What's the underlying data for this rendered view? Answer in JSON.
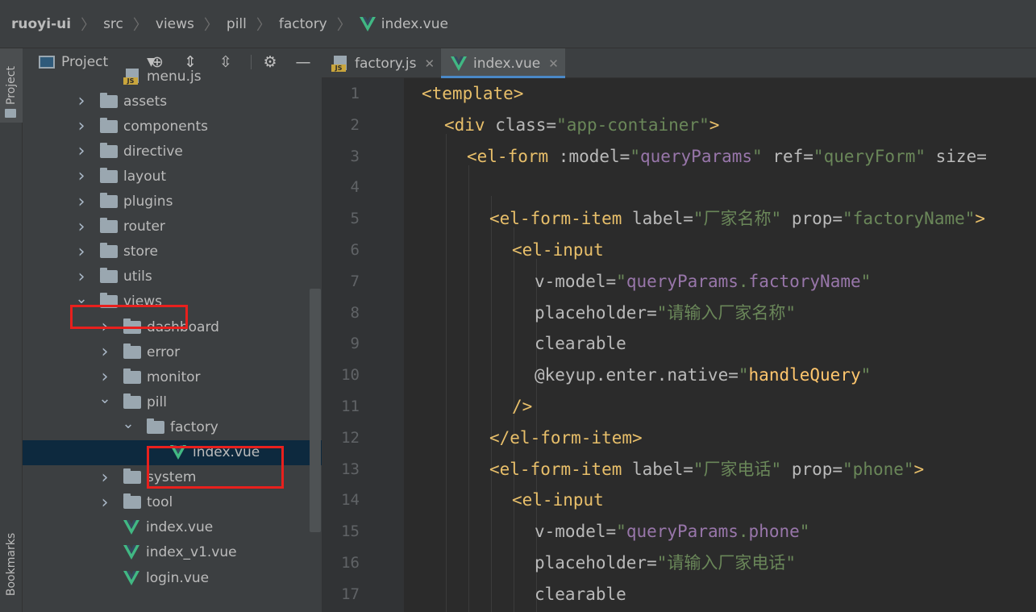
{
  "breadcrumb": {
    "items": [
      "ruoyi-ui",
      "src",
      "views",
      "pill",
      "factory",
      "index.vue"
    ]
  },
  "tool_strip": {
    "project_tab": "Project",
    "bookmarks_tab": "Bookmarks"
  },
  "project_panel": {
    "title": "Project",
    "tree": [
      {
        "label": "menu.js",
        "type": "js",
        "depth": 2,
        "expand": "none"
      },
      {
        "label": "assets",
        "type": "folder",
        "depth": 1,
        "expand": "collapsed"
      },
      {
        "label": "components",
        "type": "folder",
        "depth": 1,
        "expand": "collapsed"
      },
      {
        "label": "directive",
        "type": "folder",
        "depth": 1,
        "expand": "collapsed"
      },
      {
        "label": "layout",
        "type": "folder",
        "depth": 1,
        "expand": "collapsed"
      },
      {
        "label": "plugins",
        "type": "folder",
        "depth": 1,
        "expand": "collapsed"
      },
      {
        "label": "router",
        "type": "folder",
        "depth": 1,
        "expand": "collapsed"
      },
      {
        "label": "store",
        "type": "folder",
        "depth": 1,
        "expand": "collapsed"
      },
      {
        "label": "utils",
        "type": "folder",
        "depth": 1,
        "expand": "collapsed"
      },
      {
        "label": "views",
        "type": "folder",
        "depth": 1,
        "expand": "expanded"
      },
      {
        "label": "dashboard",
        "type": "folder",
        "depth": 2,
        "expand": "collapsed"
      },
      {
        "label": "error",
        "type": "folder",
        "depth": 2,
        "expand": "collapsed"
      },
      {
        "label": "monitor",
        "type": "folder",
        "depth": 2,
        "expand": "collapsed"
      },
      {
        "label": "pill",
        "type": "folder",
        "depth": 2,
        "expand": "expanded"
      },
      {
        "label": "factory",
        "type": "folder",
        "depth": 3,
        "expand": "expanded"
      },
      {
        "label": "index.vue",
        "type": "vue",
        "depth": 4,
        "expand": "none",
        "selected": true
      },
      {
        "label": "system",
        "type": "folder",
        "depth": 2,
        "expand": "collapsed"
      },
      {
        "label": "tool",
        "type": "folder",
        "depth": 2,
        "expand": "collapsed"
      },
      {
        "label": "index.vue",
        "type": "vue",
        "depth": 2,
        "expand": "none"
      },
      {
        "label": "index_v1.vue",
        "type": "vue",
        "depth": 2,
        "expand": "none"
      },
      {
        "label": "login.vue",
        "type": "vue",
        "depth": 2,
        "expand": "none"
      }
    ]
  },
  "editor": {
    "tabs": [
      {
        "label": "factory.js",
        "icon": "js-file-icon",
        "active": false
      },
      {
        "label": "index.vue",
        "icon": "vue-file-icon",
        "active": true
      }
    ],
    "line_numbers": [
      "1",
      "2",
      "3",
      "4",
      "5",
      "6",
      "7",
      "8",
      "9",
      "10",
      "11",
      "12",
      "13",
      "14",
      "15",
      "16",
      "17"
    ],
    "lines": [
      {
        "indent": 0,
        "tokens": [
          [
            "t-tag",
            "<template>"
          ]
        ]
      },
      {
        "indent": 1,
        "tokens": [
          [
            "t-tag",
            "<div "
          ],
          [
            "t-attr",
            "class="
          ],
          [
            "t-str",
            "\"app-container\""
          ],
          [
            "t-tag",
            ">"
          ]
        ]
      },
      {
        "indent": 2,
        "tokens": [
          [
            "t-tag",
            "<el-form "
          ],
          [
            "t-attr",
            ":model="
          ],
          [
            "t-str",
            "\""
          ],
          [
            "t-var",
            "queryParams"
          ],
          [
            "t-str",
            "\""
          ],
          [
            "t-attr",
            " ref="
          ],
          [
            "t-str",
            "\"queryForm\""
          ],
          [
            "t-attr",
            " size="
          ]
        ]
      },
      {
        "indent": 0,
        "tokens": []
      },
      {
        "indent": 3,
        "tokens": [
          [
            "t-tag",
            "<el-form-item "
          ],
          [
            "t-attr",
            "label="
          ],
          [
            "t-str",
            "\"厂家名称\""
          ],
          [
            "t-attr",
            " prop="
          ],
          [
            "t-str",
            "\"factoryName\""
          ],
          [
            "t-tag",
            ">"
          ]
        ]
      },
      {
        "indent": 4,
        "tokens": [
          [
            "t-tag",
            "<el-input"
          ]
        ]
      },
      {
        "indent": 5,
        "tokens": [
          [
            "t-attr",
            "v-model="
          ],
          [
            "t-str",
            "\""
          ],
          [
            "t-var",
            "queryParams"
          ],
          [
            "t-str",
            "."
          ],
          [
            "t-var",
            "factoryName"
          ],
          [
            "t-str",
            "\""
          ]
        ]
      },
      {
        "indent": 5,
        "tokens": [
          [
            "t-attr",
            "placeholder="
          ],
          [
            "t-str",
            "\"请输入厂家名称\""
          ]
        ]
      },
      {
        "indent": 5,
        "tokens": [
          [
            "t-attr",
            "clearable"
          ]
        ]
      },
      {
        "indent": 5,
        "tokens": [
          [
            "t-attr",
            "@keyup.enter.native="
          ],
          [
            "t-str",
            "\""
          ],
          [
            "t-fn",
            "handleQuery"
          ],
          [
            "t-str",
            "\""
          ]
        ]
      },
      {
        "indent": 4,
        "tokens": [
          [
            "t-tag",
            "/>"
          ]
        ]
      },
      {
        "indent": 3,
        "tokens": [
          [
            "t-tag",
            "</el-form-item>"
          ]
        ]
      },
      {
        "indent": 3,
        "tokens": [
          [
            "t-tag",
            "<el-form-item "
          ],
          [
            "t-attr",
            "label="
          ],
          [
            "t-str",
            "\"厂家电话\""
          ],
          [
            "t-attr",
            " prop="
          ],
          [
            "t-str",
            "\"phone\""
          ],
          [
            "t-tag",
            ">"
          ]
        ]
      },
      {
        "indent": 4,
        "tokens": [
          [
            "t-tag",
            "<el-input"
          ]
        ]
      },
      {
        "indent": 5,
        "tokens": [
          [
            "t-attr",
            "v-model="
          ],
          [
            "t-str",
            "\""
          ],
          [
            "t-var",
            "queryParams"
          ],
          [
            "t-str",
            "."
          ],
          [
            "t-var",
            "phone"
          ],
          [
            "t-str",
            "\""
          ]
        ]
      },
      {
        "indent": 5,
        "tokens": [
          [
            "t-attr",
            "placeholder="
          ],
          [
            "t-str",
            "\"请输入厂家电话\""
          ]
        ]
      },
      {
        "indent": 5,
        "tokens": [
          [
            "t-attr",
            "clearable"
          ]
        ]
      }
    ]
  },
  "colors": {
    "accent": "#4a88c7",
    "vue_green": "#41b883",
    "highlight_red": "#e8201d",
    "selection": "#0d293e"
  }
}
